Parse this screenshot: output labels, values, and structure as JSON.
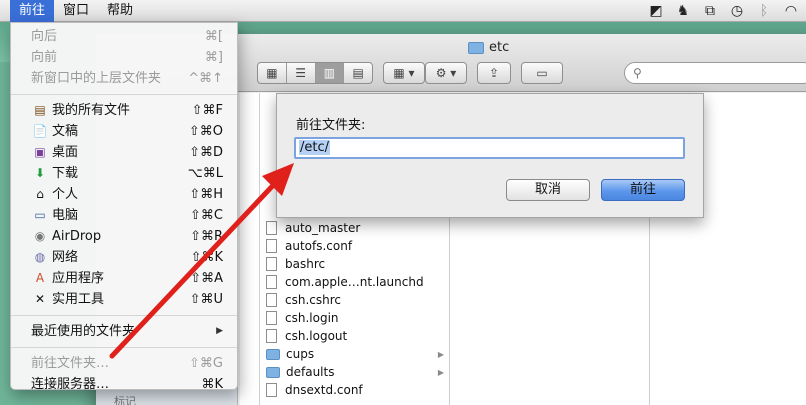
{
  "menubar": {
    "items": [
      "前往",
      "窗口",
      "帮助"
    ]
  },
  "finder": {
    "title": "etc",
    "sidebar_label": "标记",
    "files": [
      {
        "name": "auto_master",
        "type": "file"
      },
      {
        "name": "autofs.conf",
        "type": "file"
      },
      {
        "name": "bashrc",
        "type": "file"
      },
      {
        "name": "com.apple…nt.launchd",
        "type": "file"
      },
      {
        "name": "csh.cshrc",
        "type": "file"
      },
      {
        "name": "csh.login",
        "type": "file"
      },
      {
        "name": "csh.logout",
        "type": "file"
      },
      {
        "name": "cups",
        "type": "folder"
      },
      {
        "name": "defaults",
        "type": "folder"
      },
      {
        "name": "dnsextd.conf",
        "type": "file"
      }
    ]
  },
  "goto_sheet": {
    "label": "前往文件夹:",
    "input_value": "/etc/",
    "cancel": "取消",
    "go": "前往"
  },
  "go_menu": {
    "items": [
      {
        "label": "向后",
        "shortcut": "⌘[",
        "enabled": false,
        "icon": ""
      },
      {
        "label": "向前",
        "shortcut": "⌘]",
        "enabled": false,
        "icon": ""
      },
      {
        "label": "新窗口中的上层文件夹",
        "shortcut": "^⌘↑",
        "enabled": false,
        "icon": ""
      },
      {
        "label": "我的所有文件",
        "shortcut": "⇧⌘F",
        "enabled": true,
        "icon": "all-files-icon"
      },
      {
        "label": "文稿",
        "shortcut": "⇧⌘O",
        "enabled": true,
        "icon": "documents-icon"
      },
      {
        "label": "桌面",
        "shortcut": "⇧⌘D",
        "enabled": true,
        "icon": "desktop-icon"
      },
      {
        "label": "下载",
        "shortcut": "⌥⌘L",
        "enabled": true,
        "icon": "downloads-icon"
      },
      {
        "label": "个人",
        "shortcut": "⇧⌘H",
        "enabled": true,
        "icon": "home-icon"
      },
      {
        "label": "电脑",
        "shortcut": "⇧⌘C",
        "enabled": true,
        "icon": "computer-icon"
      },
      {
        "label": "AirDrop",
        "shortcut": "⇧⌘R",
        "enabled": true,
        "icon": "airdrop-icon"
      },
      {
        "label": "网络",
        "shortcut": "⇧⌘K",
        "enabled": true,
        "icon": "network-icon"
      },
      {
        "label": "应用程序",
        "shortcut": "⇧⌘A",
        "enabled": true,
        "icon": "applications-icon"
      },
      {
        "label": "实用工具",
        "shortcut": "⇧⌘U",
        "enabled": true,
        "icon": "utilities-icon"
      },
      {
        "label": "最近使用的文件夹",
        "shortcut": "",
        "enabled": true,
        "icon": ""
      },
      {
        "label": "前往文件夹…",
        "shortcut": "⇧⌘G",
        "enabled": false,
        "icon": ""
      },
      {
        "label": "连接服务器…",
        "shortcut": "⌘K",
        "enabled": true,
        "icon": ""
      }
    ]
  },
  "colors": {
    "menu_highlight": "#3a6fd8",
    "arrow": "#e0201b",
    "primary_button": "#5d97ec"
  }
}
